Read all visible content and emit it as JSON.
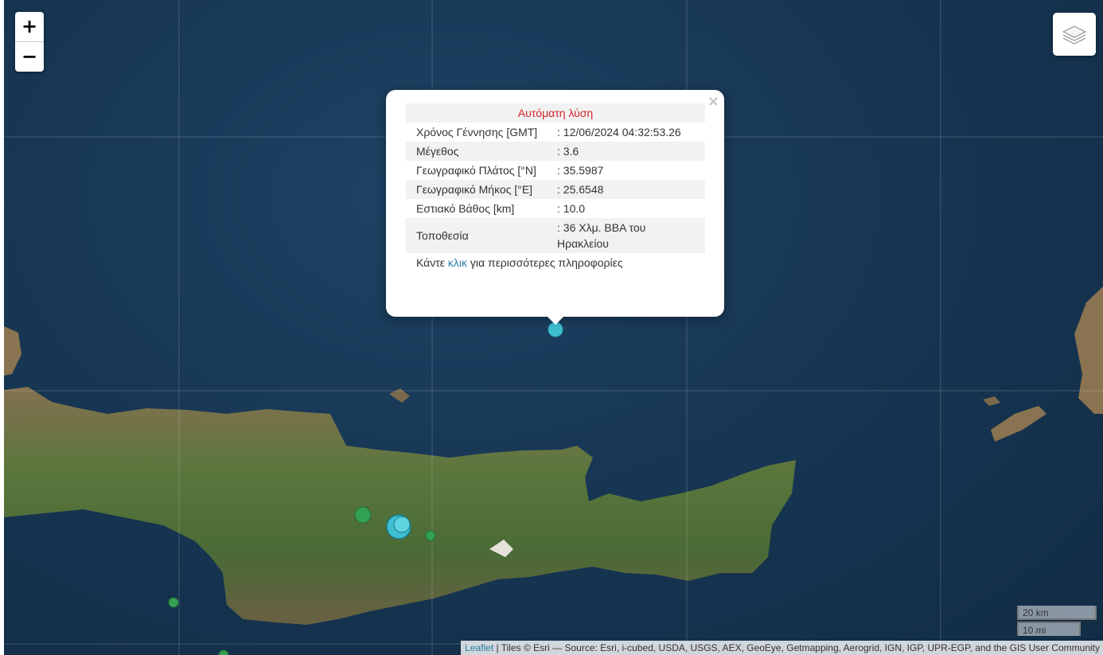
{
  "zoom": {
    "in_label": "+",
    "out_label": "−"
  },
  "layers_control": {
    "icon": "layers-icon"
  },
  "popup": {
    "title": "Αυτόματη λύση",
    "rows": [
      {
        "label": "Χρόνος Γέννησης [GMT]",
        "value": ": 12/06/2024 04:32:53.26"
      },
      {
        "label": "Μέγεθος",
        "value": ": 3.6"
      },
      {
        "label": "Γεωγραφικό Πλάτος [°N]",
        "value": ": 35.5987"
      },
      {
        "label": "Γεωγραφικό Μήκος [°E]",
        "value": ": 25.6548"
      },
      {
        "label": "Εστιακό Βάθος [km]",
        "value": ": 10.0"
      },
      {
        "label": "Τοποθεσία",
        "value": ": 36 Χλμ. ΒΒΑ του Ηρακλείου"
      }
    ],
    "footer_prefix": "Κάντε ",
    "footer_link": "κλικ",
    "footer_suffix": " για περισσότερες πληροφορίες",
    "close_symbol": "×"
  },
  "scale": {
    "metric": "20 km",
    "imperial": "10 mi"
  },
  "attribution": {
    "link": "Leaflet",
    "text": " | Tiles © Esri — Source: Esri, i-cubed, USDA, USGS, AEX, GeoEye, Getmapping, Aerogrid, IGN, IGP, UPR-EGP, and the GIS User Community"
  },
  "colors": {
    "marker_cyan": "#3ebfd1",
    "marker_green": "#33a154",
    "popup_title": "#d0232a",
    "link": "#2a7fa6"
  }
}
